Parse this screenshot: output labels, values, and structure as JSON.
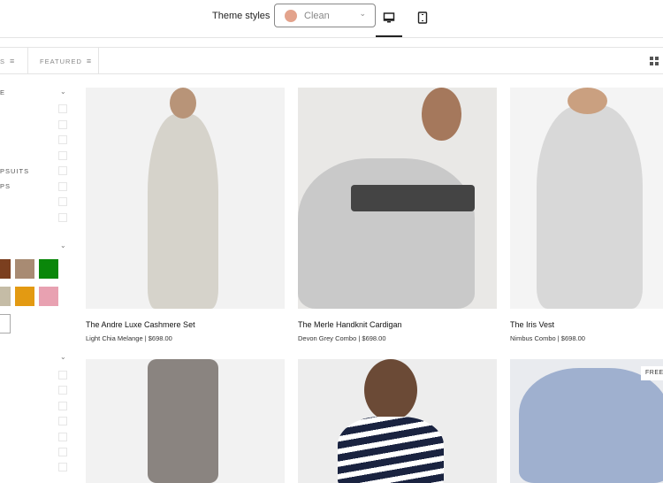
{
  "topbar": {
    "theme_label": "Theme styles",
    "theme_value": "Clean",
    "theme_color": "#e3a38c",
    "active_device": "desktop"
  },
  "toolbar": {
    "filter_partial": "S",
    "sort_label": "FEATURED"
  },
  "sidebar": {
    "section1_partial": "E",
    "items": [
      "PSUITS",
      "PS"
    ],
    "swatches": [
      "#7b3f1f",
      "#a88b73",
      "#0a870a",
      "#c5bca6",
      "#e39a12",
      "#e8a1b1",
      "#ffffff"
    ]
  },
  "products": [
    {
      "title": "The Andre Luxe Cashmere Set",
      "subtitle": "Light Chia Melange | $698.00"
    },
    {
      "title": "The Merle Handknit Cardigan",
      "subtitle": "Devon Grey Combo | $698.00"
    },
    {
      "title": "The Iris Vest",
      "subtitle": "Nimbus Combo | $698.00"
    },
    {
      "title": "",
      "subtitle": ""
    },
    {
      "title": "",
      "subtitle": ""
    },
    {
      "title": "",
      "subtitle": "",
      "badge": "FREE"
    }
  ]
}
